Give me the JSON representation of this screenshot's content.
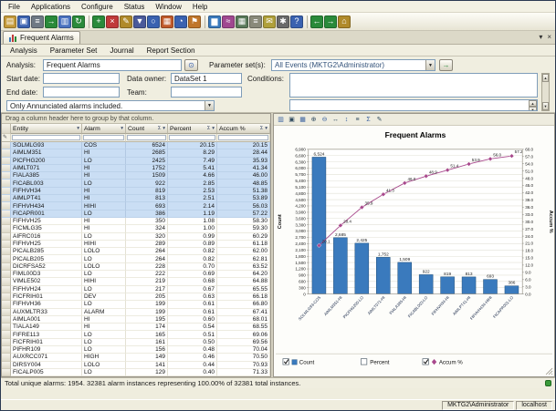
{
  "menubar": {
    "items": [
      "File",
      "Applications",
      "Configure",
      "Status",
      "Window",
      "Help"
    ]
  },
  "toolbar": {
    "groups": [
      [
        {
          "name": "open-icon",
          "glyph": "▤",
          "color": "#c49a3a"
        },
        {
          "name": "save-icon",
          "glyph": "▣",
          "color": "#3a62b0"
        },
        {
          "name": "print-icon",
          "glyph": "≡",
          "color": "#6f7984"
        },
        {
          "name": "export-icon",
          "glyph": "→",
          "color": "#2a8a3a"
        },
        {
          "name": "copy-icon",
          "glyph": "▥",
          "color": "#4a72c0"
        },
        {
          "name": "refresh-icon",
          "glyph": "↻",
          "color": "#2a8a3a"
        }
      ],
      [
        {
          "name": "add-icon",
          "glyph": "+",
          "color": "#2a8a3a"
        },
        {
          "name": "delete-icon",
          "glyph": "×",
          "color": "#c03a3a"
        },
        {
          "name": "edit-icon",
          "glyph": "✎",
          "color": "#b08a2a"
        },
        {
          "name": "filter-icon",
          "glyph": "▼",
          "color": "#4a5a9a"
        },
        {
          "name": "find-icon",
          "glyph": "○",
          "color": "#3a62b0"
        },
        {
          "name": "calendar-icon",
          "glyph": "▦",
          "color": "#c05a2a"
        },
        {
          "name": "clock-icon",
          "glyph": "◔",
          "color": "#3a62b0"
        },
        {
          "name": "alarm-flag-icon",
          "glyph": "⚑",
          "color": "#c0762a"
        }
      ],
      [
        {
          "name": "chart-bar-icon",
          "glyph": "▆",
          "color": "#3a7abd"
        },
        {
          "name": "chart-line-icon",
          "glyph": "≈",
          "color": "#a04890"
        },
        {
          "name": "table-icon",
          "glyph": "▦",
          "color": "#5a7a5a"
        },
        {
          "name": "report-icon",
          "glyph": "≡",
          "color": "#8a8a7a"
        },
        {
          "name": "mail-icon",
          "glyph": "✉",
          "color": "#b0a03a"
        },
        {
          "name": "settings-icon",
          "glyph": "✱",
          "color": "#6a6a6a"
        },
        {
          "name": "help-icon",
          "glyph": "?",
          "color": "#3a62b0"
        }
      ],
      [
        {
          "name": "back-icon",
          "glyph": "←",
          "color": "#2a8a3a"
        },
        {
          "name": "forward-icon",
          "glyph": "→",
          "color": "#2a8a3a"
        },
        {
          "name": "home-icon",
          "glyph": "⌂",
          "color": "#b08a2a"
        }
      ]
    ]
  },
  "tab": {
    "label": "Frequent Alarms",
    "chevron": "▾",
    "close": "×"
  },
  "ribbon": {
    "items": [
      "Analysis",
      "Parameter Set",
      "Journal",
      "Report Section"
    ]
  },
  "params": {
    "analysis_label": "Analysis:",
    "analysis_value": "Frequent Alarms",
    "paramset_label": "Parameter set(s):",
    "paramset_value": "All Events (MKTG2\\Administrator)",
    "start_label": "Start date:",
    "end_label": "End date:",
    "owner_label": "Data owner:",
    "owner_value": "DataSet 1",
    "team_label": "Team:",
    "team_value": "",
    "conditions_label": "Conditions:",
    "filter_note": "Only Annunciated alarms included."
  },
  "grid": {
    "group_hint": "Drag a column header here to group by that column.",
    "columns": [
      {
        "label": "Entity",
        "sigma": false
      },
      {
        "label": "Alarm",
        "sigma": false
      },
      {
        "label": "Count",
        "sigma": true
      },
      {
        "label": "Percent",
        "sigma": true
      },
      {
        "label": "Accum %",
        "sigma": true
      }
    ],
    "selected_count": 10,
    "rows": [
      [
        "SOLMLG93",
        "COS",
        "6524",
        "20.15",
        "20.15"
      ],
      [
        "AIMLM351",
        "HI",
        "2685",
        "8.29",
        "28.44"
      ],
      [
        "PICFHG200",
        "LO",
        "2425",
        "7.49",
        "35.93"
      ],
      [
        "AIMLT071",
        "HI",
        "1752",
        "5.41",
        "41.34"
      ],
      [
        "FIALA385",
        "HI",
        "1509",
        "4.66",
        "46.00"
      ],
      [
        "FICABL003",
        "LO",
        "922",
        "2.85",
        "48.85"
      ],
      [
        "FIFHVH34",
        "HI",
        "819",
        "2.53",
        "51.38"
      ],
      [
        "AIMLPT41",
        "HI",
        "813",
        "2.51",
        "53.89"
      ],
      [
        "FIFHVH434",
        "HIHI",
        "693",
        "2.14",
        "56.03"
      ],
      [
        "FICAPR001",
        "LO",
        "386",
        "1.19",
        "57.22"
      ],
      [
        "FIFHVH25",
        "HI",
        "350",
        "1.08",
        "58.30"
      ],
      [
        "FICMLG35",
        "HI",
        "324",
        "1.00",
        "59.30"
      ],
      [
        "AIFRC016",
        "LO",
        "320",
        "0.99",
        "60.29"
      ],
      [
        "FIFHVH25",
        "HIHI",
        "289",
        "0.89",
        "61.18"
      ],
      [
        "PICALB285",
        "LOLO",
        "264",
        "0.82",
        "62.00"
      ],
      [
        "PICALB205",
        "LO",
        "264",
        "0.82",
        "62.81"
      ],
      [
        "DICRFSA52",
        "LOLO",
        "228",
        "0.70",
        "63.52"
      ],
      [
        "FIML00D3",
        "LO",
        "222",
        "0.69",
        "64.20"
      ],
      [
        "VIMLE502",
        "HIHI",
        "219",
        "0.68",
        "64.88"
      ],
      [
        "FIFHVH24",
        "LO",
        "217",
        "0.67",
        "65.55"
      ],
      [
        "FICFRIH01",
        "DEV",
        "205",
        "0.63",
        "66.18"
      ],
      [
        "FIFHVH36",
        "LO",
        "199",
        "0.61",
        "66.80"
      ],
      [
        "AUXMLTR33",
        "ALARM",
        "199",
        "0.61",
        "67.41"
      ],
      [
        "AIMLA001",
        "HI",
        "195",
        "0.60",
        "68.01"
      ],
      [
        "TIALA149",
        "HI",
        "174",
        "0.54",
        "68.55"
      ],
      [
        "FIFRE113",
        "LO",
        "165",
        "0.51",
        "69.06"
      ],
      [
        "FICFRIH01",
        "LO",
        "161",
        "0.50",
        "69.56"
      ],
      [
        "PIFHR109",
        "LO",
        "156",
        "0.48",
        "70.04"
      ],
      [
        "AUXRCC071",
        "HIGH",
        "149",
        "0.46",
        "70.50"
      ],
      [
        "DIRSY004",
        "LOLO",
        "141",
        "0.44",
        "70.93"
      ],
      [
        "FICALP005",
        "LO",
        "129",
        "0.40",
        "71.33"
      ]
    ]
  },
  "chart_toolbar": {
    "icons": [
      {
        "name": "copy-chart-icon",
        "glyph": "▥"
      },
      {
        "name": "save-chart-icon",
        "glyph": "▣"
      },
      {
        "name": "chart-type-icon",
        "glyph": "▦"
      },
      {
        "name": "zoom-in-icon",
        "glyph": "⊕"
      },
      {
        "name": "zoom-out-icon",
        "glyph": "⊖"
      },
      {
        "name": "pan-horizontal-icon",
        "glyph": "↔"
      },
      {
        "name": "pan-vertical-icon",
        "glyph": "↕"
      },
      {
        "name": "chart-options-icon",
        "glyph": "≡"
      },
      {
        "name": "totals-icon",
        "glyph": "Σ"
      },
      {
        "name": "annotate-icon",
        "glyph": "✎"
      }
    ]
  },
  "chart_data": {
    "type": "bar",
    "subtype": "pareto",
    "title": "Frequent Alarms",
    "categories": [
      "SOLMLG93-COS",
      "AIMLM351-HI",
      "PICFHG200-LO",
      "AIMLT071-HI",
      "FIALA385-HI",
      "FICABL003-LO",
      "FIFHVH34-HI",
      "AIMLPT41-HI",
      "FIFHVH434-HIHI",
      "FICAPR001-LO"
    ],
    "series": [
      {
        "name": "Count",
        "type": "bar",
        "axis": "left",
        "color": "#3a7abd",
        "values": [
          6524,
          2685,
          2425,
          1752,
          1509,
          922,
          819,
          813,
          693,
          386
        ]
      },
      {
        "name": "Accum %",
        "type": "line",
        "axis": "right",
        "color": "#a8488c",
        "values": [
          20.15,
          28.44,
          35.93,
          41.34,
          46.0,
          48.85,
          51.38,
          53.89,
          56.03,
          57.22
        ]
      }
    ],
    "left_axis": {
      "label": "Count",
      "min": 0,
      "max": 6900,
      "step": 300
    },
    "right_axis": {
      "label": "Accum %",
      "min": 0,
      "max": 60,
      "step": 3
    },
    "grid": true,
    "legend_position": "bottom",
    "legend": [
      {
        "label": "Count",
        "checked": true,
        "marker": "square"
      },
      {
        "label": "Percent",
        "checked": false,
        "marker": "none"
      },
      {
        "label": "Accum %",
        "checked": true,
        "marker": "diamond"
      }
    ]
  },
  "status": {
    "summary": "Total unique alarms: 1954. 32381 alarm instances representing 100.00% of 32381 total instances.",
    "user": "MKTG2\\Administrator",
    "host": "localhost"
  }
}
